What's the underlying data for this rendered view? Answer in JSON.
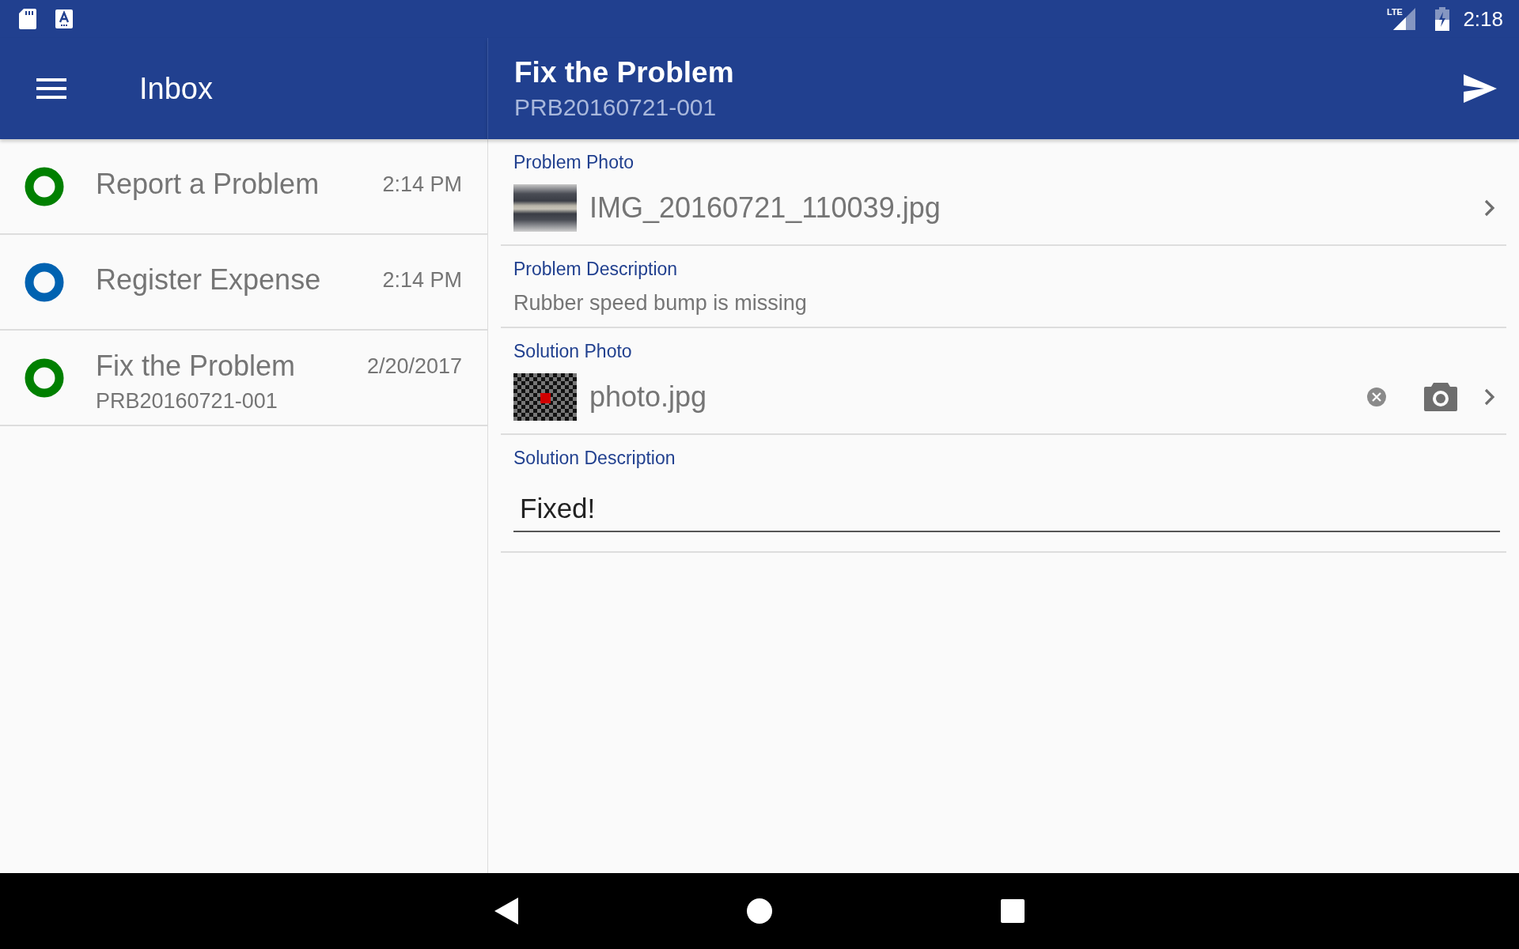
{
  "status_bar": {
    "network": "LTE",
    "time": "2:18"
  },
  "inbox": {
    "title": "Inbox",
    "items": [
      {
        "title": "Report a Problem",
        "time": "2:14 PM",
        "color": "#008000"
      },
      {
        "title": "Register Expense",
        "time": "2:14 PM",
        "color": "#0062b1"
      },
      {
        "title": "Fix the Problem",
        "subtitle": "PRB20160721-001",
        "time": "2/20/2017",
        "color": "#008000"
      }
    ]
  },
  "detail": {
    "title": "Fix the Problem",
    "subtitle": "PRB20160721-001",
    "fields": [
      {
        "kind": "photo",
        "label": "Problem Photo",
        "value": "IMG_20160721_110039.jpg",
        "thumbnail": {
          "kind": "photo"
        },
        "editable": false
      },
      {
        "kind": "text",
        "label": "Problem Description",
        "value": "Rubber speed bump is missing"
      },
      {
        "kind": "photo",
        "label": "Solution Photo",
        "value": "photo.jpg",
        "thumbnail": {
          "kind": "checker"
        },
        "editable": true
      },
      {
        "kind": "input",
        "label": "Solution Description",
        "value": "Fixed!"
      }
    ]
  }
}
